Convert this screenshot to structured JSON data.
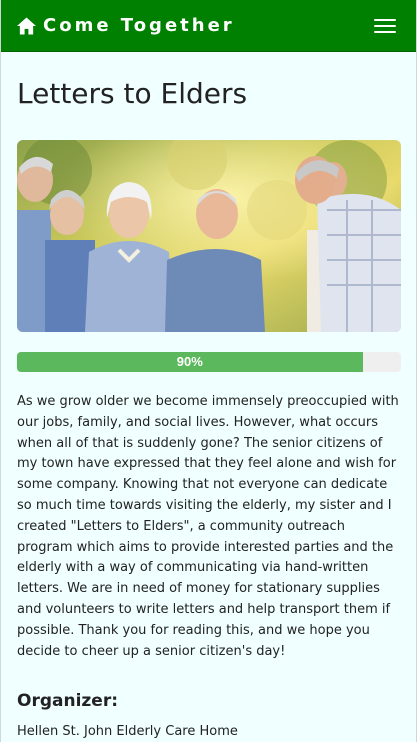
{
  "navbar": {
    "brand": "Come Together",
    "brand_icon": "home-icon",
    "menu_icon": "hamburger-menu-icon",
    "color": "#008000"
  },
  "page": {
    "title": "Letters to Elders",
    "photo_subject": "smiling elderly people standing together outdoors"
  },
  "progress": {
    "label": "90%",
    "fraction": 0.9,
    "fill_color": "#5cb85c"
  },
  "description": "As we grow older we become immensely preoccupied with our jobs, family, and social lives. However, what occurs when all of that is suddenly gone? The senior citizens of my town have expressed that they feel alone and wish for some company. Knowing that not everyone can dedicate so much time towards visiting the elderly, my sister and I created \"Letters to Elders\", a community outreach program which aims to provide interested parties and the elderly with a way of communicating via hand-written letters. We are in need of money for stationary supplies and volunteers to write letters and help transport them if possible. Thank you for reading this, and we hope you decide to cheer up a senior citizen's day!",
  "organizer": {
    "heading": "Organizer:",
    "name": "Hellen St. John Elderly Care Home"
  }
}
